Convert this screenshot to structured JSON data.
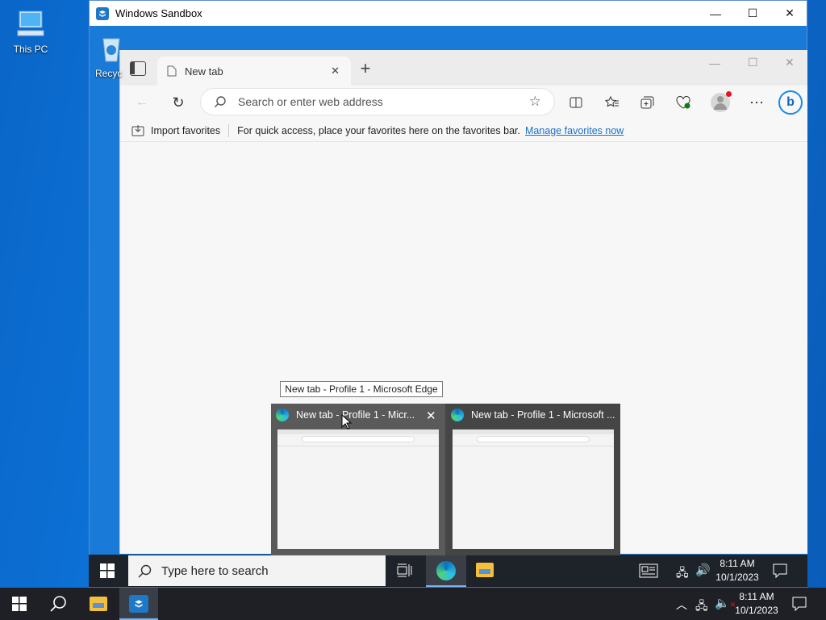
{
  "desktop": {
    "icons": [
      {
        "label": "This PC"
      },
      {
        "label": "Recyc"
      }
    ]
  },
  "sandbox": {
    "title": "Windows Sandbox",
    "controls": {
      "minimize": "—",
      "maximize": "☐",
      "close": "✕"
    }
  },
  "edge": {
    "tab_title": "New tab",
    "new_tab": "+",
    "address_placeholder": "Search or enter web address",
    "favorites_bar": {
      "import_label": "Import favorites",
      "message": "For quick access, place your favorites here on the favorites bar.",
      "link": "Manage favorites now"
    }
  },
  "inner_taskbar": {
    "search_placeholder": "Type here to search",
    "time": "8:11 AM",
    "date": "10/1/2023"
  },
  "preview": {
    "tooltip": "New tab - Profile 1 - Microsoft Edge",
    "windows": [
      {
        "title": "New tab - Profile 1 - Micr..."
      },
      {
        "title": "New tab - Profile 1 - Microsoft ..."
      }
    ]
  },
  "outer_taskbar": {
    "time": "8:11 AM",
    "date": "10/1/2023"
  },
  "colors": {
    "accent": "#0078d4",
    "link": "#1a6fc4"
  }
}
